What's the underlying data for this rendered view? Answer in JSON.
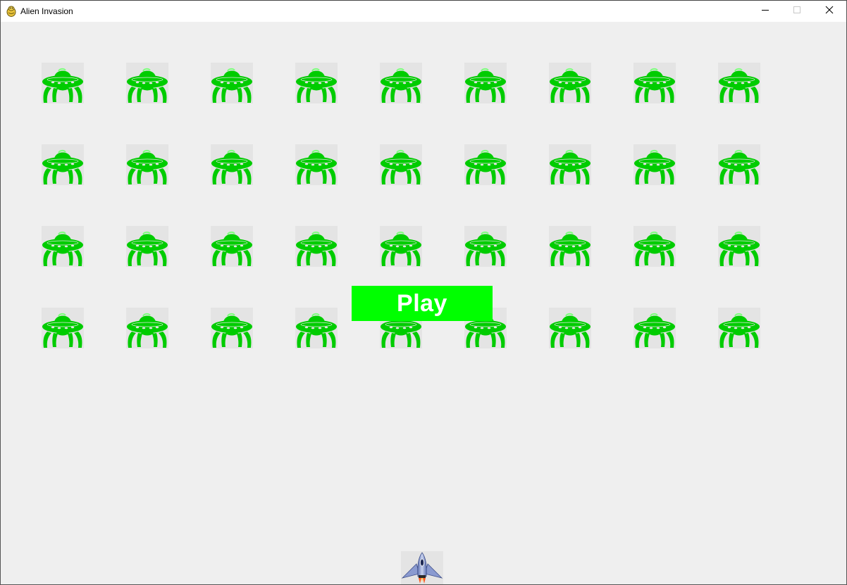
{
  "window": {
    "title": "Alien Invasion",
    "app_icon": "pygame-snake-icon",
    "controls": {
      "minimize_icon": "minimize-icon",
      "maximize_icon": "maximize-icon",
      "close_icon": "close-icon"
    }
  },
  "game": {
    "background_color": "#efefef",
    "alien_color": "#00cc00",
    "alien_icon": "ufo-alien-icon",
    "alien_fleet": {
      "rows": 4,
      "columns": 9
    },
    "play_button": {
      "label": "Play",
      "background_color": "#00ff00",
      "text_color": "#ffffff"
    },
    "ship_icon": "rocket-ship-icon"
  }
}
